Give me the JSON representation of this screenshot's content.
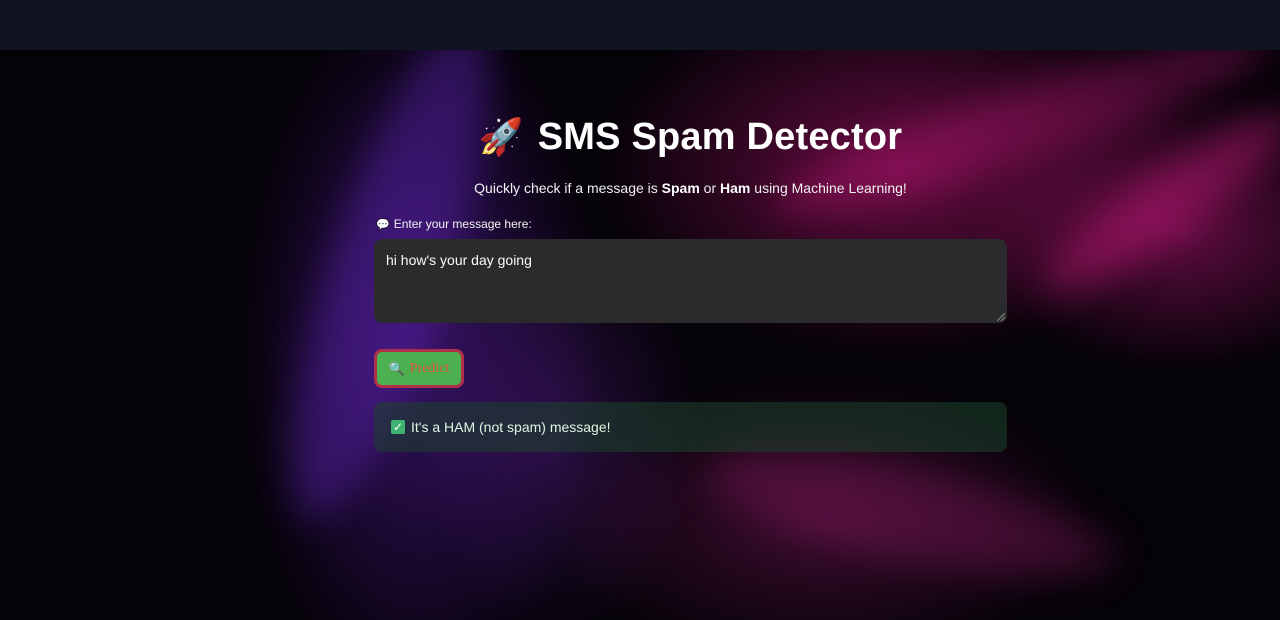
{
  "header": {
    "title_icon": "🚀",
    "title": "SMS Spam Detector"
  },
  "subtitle": {
    "prefix": "Quickly check if a message is ",
    "spam": "Spam",
    "middle": " or ",
    "ham": "Ham",
    "suffix": " using Machine Learning!"
  },
  "input": {
    "label_icon": "💬",
    "label": "Enter your message here:",
    "value": "hi how's your day going",
    "placeholder": ""
  },
  "predict_button": {
    "icon": "🔍",
    "label": "Predict"
  },
  "result": {
    "icon": "✓",
    "text": "It's a HAM (not spam) message!"
  },
  "colors": {
    "topbar": "#0f1420",
    "button_bg": "#4caf50",
    "button_border": "#b0304a",
    "button_text": "#e4553c",
    "result_bg": "#1c442c",
    "textarea_bg": "#2b2b2d"
  }
}
